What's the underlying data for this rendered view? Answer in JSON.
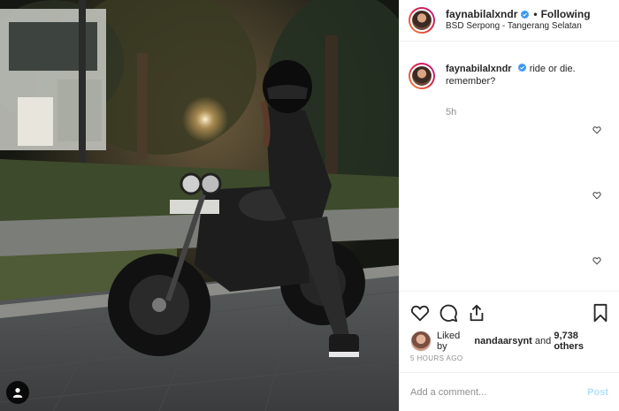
{
  "post": {
    "username": "faynabilalxndr",
    "follow_state": "Following",
    "separator": "•",
    "location": "BSD Serpong - Tangerang Selatan",
    "caption_line1": "ride or die.",
    "caption_line2": "remember?",
    "caption_time": "5h",
    "likes_prefix": "Liked by",
    "liked_by_user": "nandaarsynt",
    "likes_and": "and",
    "likes_count": "9,738 others",
    "posted_ago": "5 HOURS AGO",
    "comment_placeholder": "Add a comment...",
    "post_button": "Post"
  },
  "colors": {
    "verified_blue": "#3897f0",
    "text_dark": "#262626",
    "text_muted": "#8e8e8e",
    "post_disabled": "#b2dffc",
    "border": "#efefef"
  },
  "icons": [
    "verified-badge-icon",
    "heart-icon",
    "comment-icon",
    "share-icon",
    "bookmark-icon",
    "user-tag-icon"
  ]
}
